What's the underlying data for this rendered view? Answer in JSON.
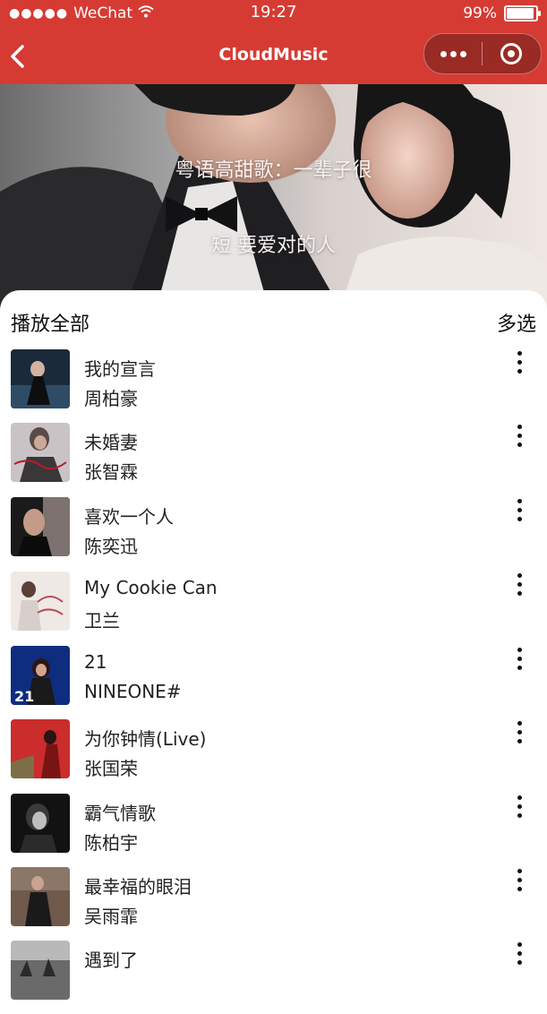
{
  "status_bar": {
    "carrier": "WeChat",
    "time": "19:27",
    "battery_text": "99%",
    "battery_level": 0.99
  },
  "nav": {
    "title": "CloudMusic"
  },
  "banner": {
    "line1": "粤语高甜歌：一辈子很",
    "line2": "短 要爱对的人"
  },
  "list_header": {
    "play_all": "播放全部",
    "multi_select": "多选"
  },
  "songs": [
    {
      "title": "我的宣言",
      "artist": "周柏豪"
    },
    {
      "title": "未婚妻",
      "artist": "张智霖"
    },
    {
      "title": "喜欢一个人",
      "artist": "陈奕迅"
    },
    {
      "title": "My Cookie Can",
      "artist": "卫兰"
    },
    {
      "title": "21",
      "artist": "NINEONE#"
    },
    {
      "title": "为你钟情(Live)",
      "artist": "张国荣"
    },
    {
      "title": "霸气情歌",
      "artist": "陈柏宇"
    },
    {
      "title": "最幸福的眼泪",
      "artist": "吴雨霏"
    },
    {
      "title": "遇到了",
      "artist": ""
    }
  ],
  "colors": {
    "accent": "#d63b33",
    "text": "#222222"
  },
  "icons": {
    "back": "chevron-left-icon",
    "more": "more-dots-icon",
    "close": "record-circle-icon",
    "song_more": "vertical-dots-icon"
  }
}
